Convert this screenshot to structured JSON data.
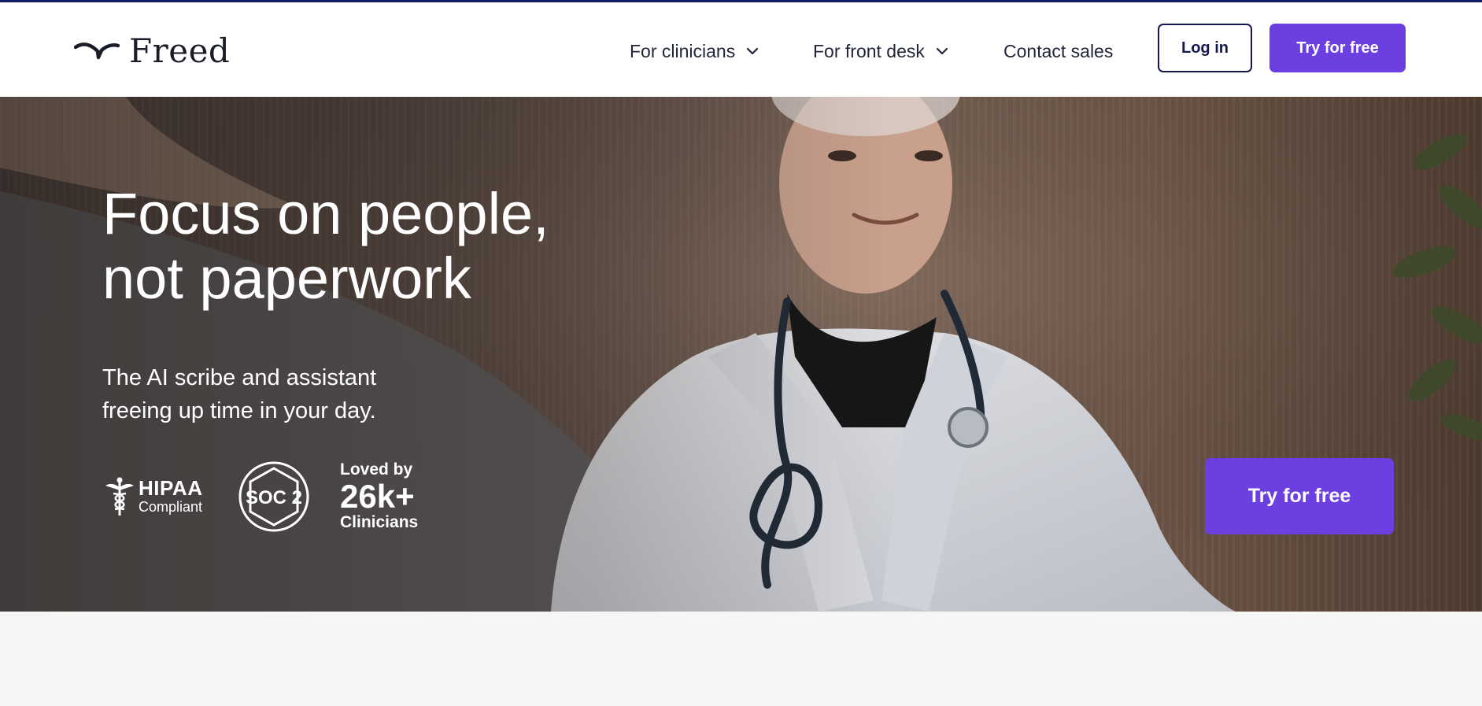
{
  "brand": {
    "name": "Freed",
    "colors": {
      "accent": "#6b3fe0",
      "navy": "#16184f",
      "top_line": "#101a66"
    }
  },
  "nav": {
    "items": [
      {
        "label": "For clinicians",
        "has_dropdown": true,
        "icon": "chevron-down-icon"
      },
      {
        "label": "For front desk",
        "has_dropdown": true,
        "icon": "chevron-down-icon"
      },
      {
        "label": "Contact sales",
        "has_dropdown": false
      }
    ],
    "login_label": "Log in",
    "try_label": "Try for free"
  },
  "hero": {
    "title_line1": "Focus on people,",
    "title_line2": "not paperwork",
    "subtitle": "The AI scribe and assistant freeing up time in your day.",
    "badges": {
      "hipaa": {
        "title": "HIPAA",
        "subtitle": "Compliant",
        "icon": "caduceus-icon"
      },
      "soc2": {
        "label": "SOC 2",
        "icon": "soc2-badge-icon"
      },
      "loved": {
        "prefix": "Loved by",
        "count": "26k+",
        "suffix": "Clinicians"
      }
    },
    "cta_label": "Try for free",
    "image": "doctor-with-stethoscope-photo"
  }
}
